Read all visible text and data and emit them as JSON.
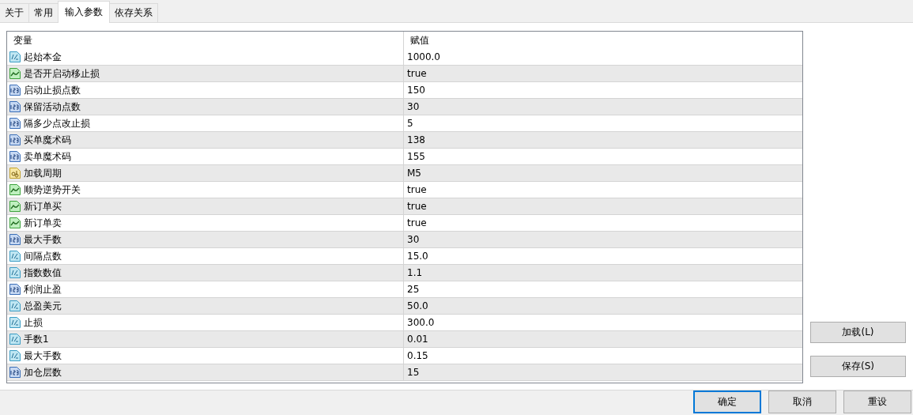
{
  "tabs": [
    {
      "label": "关于",
      "selected": false
    },
    {
      "label": "常用",
      "selected": false
    },
    {
      "label": "输入参数",
      "selected": true
    },
    {
      "label": "依存关系",
      "selected": false
    }
  ],
  "table": {
    "columns": [
      "变量",
      "赋值"
    ],
    "rows": [
      {
        "kind": "double",
        "name": "起始本金",
        "value": "1000.0"
      },
      {
        "kind": "bool",
        "name": "是否开启动移止损",
        "value": "true"
      },
      {
        "kind": "int",
        "name": "启动止损点数",
        "value": "150"
      },
      {
        "kind": "int",
        "name": "保留活动点数",
        "value": "30"
      },
      {
        "kind": "int",
        "name": "隔多少点改止损",
        "value": "5"
      },
      {
        "kind": "int",
        "name": "买单魔术码",
        "value": "138"
      },
      {
        "kind": "int",
        "name": "卖单魔术码",
        "value": "155"
      },
      {
        "kind": "string",
        "name": "加载周期",
        "value": "M5"
      },
      {
        "kind": "bool",
        "name": "顺势逆势开关",
        "value": "true"
      },
      {
        "kind": "bool",
        "name": "新订单买",
        "value": "true"
      },
      {
        "kind": "bool",
        "name": "新订单卖",
        "value": "true"
      },
      {
        "kind": "int",
        "name": "最大手数",
        "value": "30"
      },
      {
        "kind": "double",
        "name": "间隔点数",
        "value": "15.0"
      },
      {
        "kind": "double",
        "name": "指数数值",
        "value": "1.1"
      },
      {
        "kind": "int",
        "name": "利润止盈",
        "value": "25"
      },
      {
        "kind": "double",
        "name": "总盈美元",
        "value": "50.0"
      },
      {
        "kind": "double",
        "name": "止损",
        "value": "300.0"
      },
      {
        "kind": "double",
        "name": "手数1",
        "value": "0.01"
      },
      {
        "kind": "double",
        "name": "最大手数",
        "value": "0.15"
      },
      {
        "kind": "int",
        "name": "加仓层数",
        "value": "15"
      }
    ]
  },
  "side_buttons": [
    "加载(L)",
    "保存(S)"
  ],
  "footer_buttons": [
    {
      "label": "确定",
      "default": true
    },
    {
      "label": "取消",
      "default": false
    },
    {
      "label": "重设",
      "default": false
    }
  ]
}
